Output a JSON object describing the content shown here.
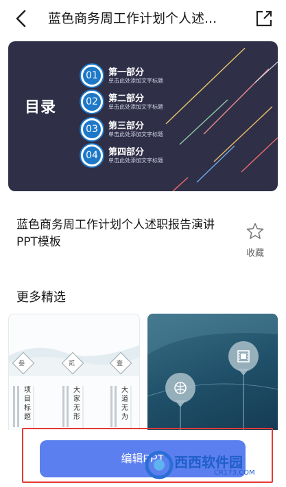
{
  "header": {
    "title": "蓝色商务周工作计划个人述..."
  },
  "preview": {
    "toc_title": "目录",
    "items": [
      {
        "num": "01",
        "head": "第一部分",
        "sub": "单击此处添加文字标题"
      },
      {
        "num": "02",
        "head": "第二部分",
        "sub": "单击此处添加文字标题"
      },
      {
        "num": "03",
        "head": "第三部分",
        "sub": "单击此处添加文字标题"
      },
      {
        "num": "04",
        "head": "第四部分",
        "sub": "单击此处添加文字标题"
      }
    ]
  },
  "doc": {
    "name": "蓝色商务周工作计划个人述职报告演讲PPT模板",
    "fav_label": "收藏"
  },
  "more": {
    "title": "更多精选",
    "card1": {
      "labels": [
        "叁",
        "贰",
        "壹"
      ],
      "columns": [
        "项目标题",
        "大家无形",
        "大道无为"
      ]
    }
  },
  "bottom": {
    "edit_label": "编辑PPT"
  },
  "watermark": {
    "text": "西西软件园",
    "sub": "CR173.COM"
  },
  "colors": {
    "button": "#5b7fee",
    "slide_bg": "#2f2f48",
    "accent": "#1e78c8",
    "highlight": "#e53935"
  }
}
